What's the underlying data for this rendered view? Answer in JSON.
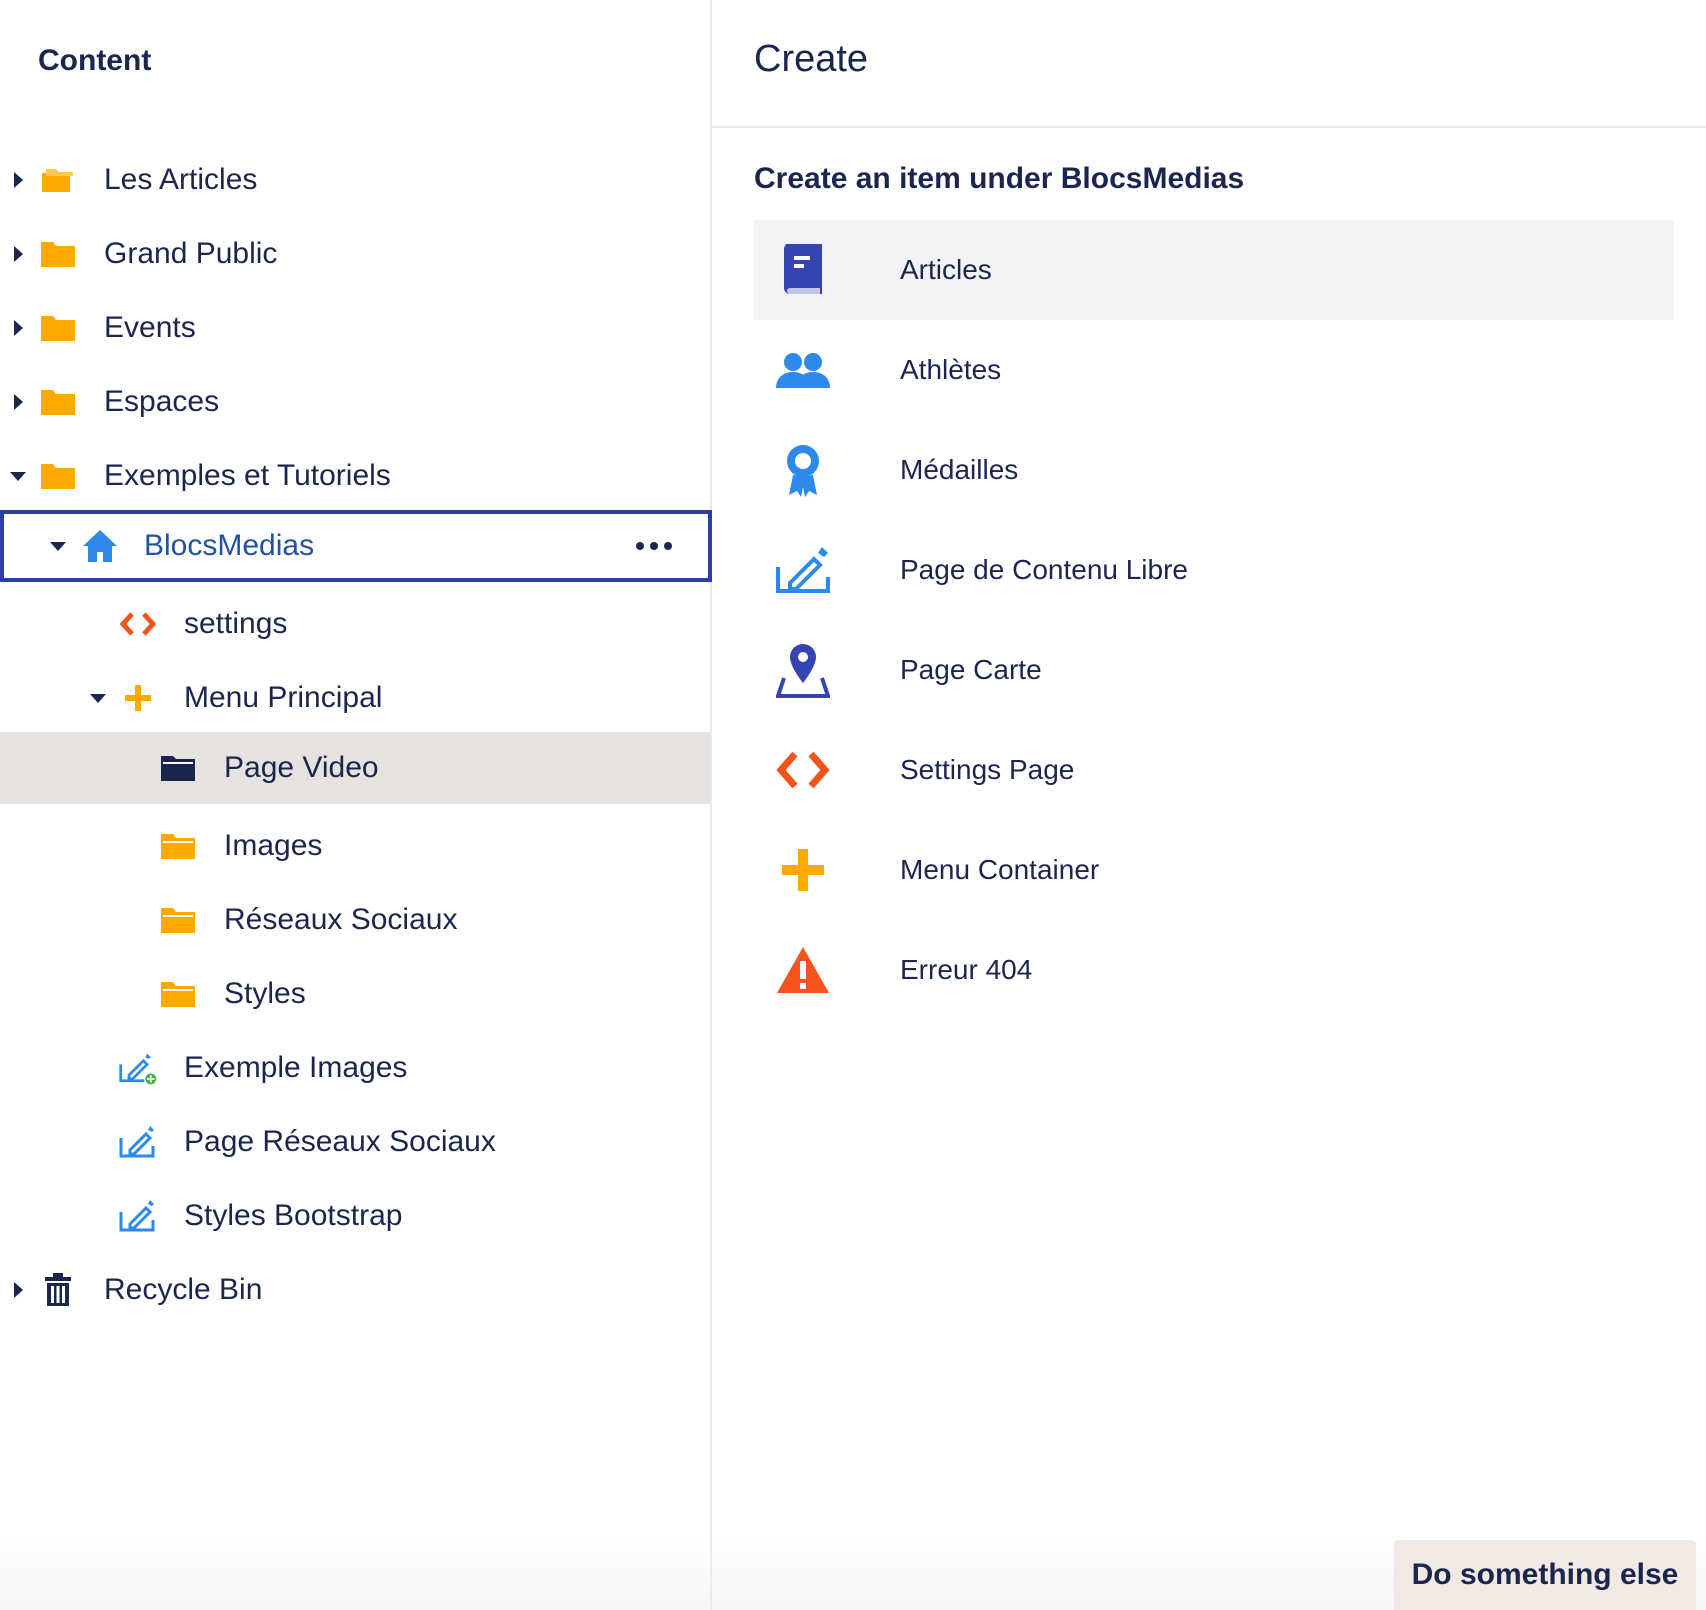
{
  "tree": {
    "title": "Content",
    "items": [
      {
        "label": "Les Articles",
        "icon": "folder-open-icon"
      },
      {
        "label": "Grand Public",
        "icon": "folder-icon"
      },
      {
        "label": "Events",
        "icon": "folder-icon"
      },
      {
        "label": "Espaces",
        "icon": "folder-icon"
      },
      {
        "label": "Exemples et Tutoriels",
        "icon": "folder-icon"
      },
      {
        "label": "BlocsMedias",
        "icon": "home-icon"
      },
      {
        "label": "settings",
        "icon": "code-icon"
      },
      {
        "label": "Menu Principal",
        "icon": "plus-icon"
      },
      {
        "label": "Page Video",
        "icon": "folder-dark-icon"
      },
      {
        "label": "Images",
        "icon": "folder-icon"
      },
      {
        "label": "Réseaux Sociaux",
        "icon": "folder-icon"
      },
      {
        "label": "Styles",
        "icon": "folder-icon"
      },
      {
        "label": "Exemple Images",
        "icon": "edit-add-icon"
      },
      {
        "label": "Page Réseaux Sociaux",
        "icon": "edit-icon"
      },
      {
        "label": "Styles Bootstrap",
        "icon": "edit-icon"
      },
      {
        "label": "Recycle Bin",
        "icon": "trash-icon"
      }
    ]
  },
  "create": {
    "title": "Create",
    "subtitle": "Create an item under BlocsMedias",
    "items": [
      {
        "label": "Articles",
        "icon": "book-icon"
      },
      {
        "label": "Athlètes",
        "icon": "users-icon"
      },
      {
        "label": "Médailles",
        "icon": "medal-icon"
      },
      {
        "label": "Page de Contenu Libre",
        "icon": "edit-icon"
      },
      {
        "label": "Page Carte",
        "icon": "map-pin-icon"
      },
      {
        "label": "Settings Page",
        "icon": "code-icon"
      },
      {
        "label": "Menu Container",
        "icon": "plus-icon"
      },
      {
        "label": "Erreur 404",
        "icon": "warning-icon"
      }
    ],
    "secondary_button": "Do something else"
  },
  "colors": {
    "navy": "#1b264f",
    "folder": "#ffa800",
    "selected_border": "#2e3fa3",
    "hover_bg": "#e5e2df",
    "code_red": "#f5541c",
    "blue": "#2e8aea",
    "indigo": "#3544b1"
  }
}
